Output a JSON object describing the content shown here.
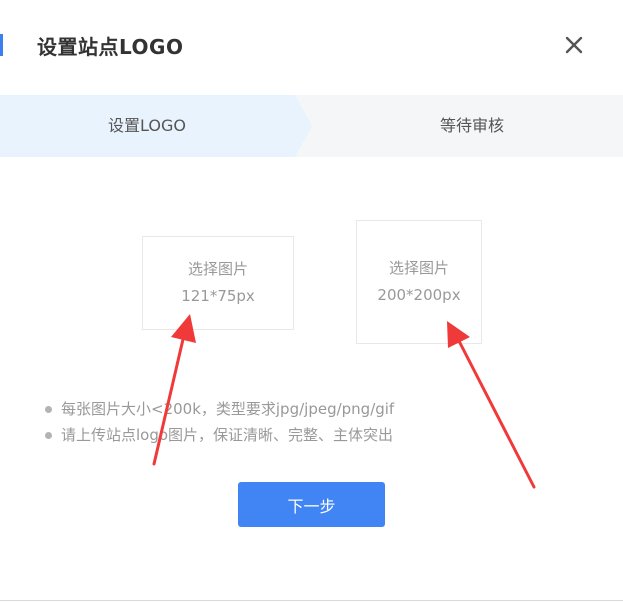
{
  "dialog": {
    "title": "设置站点LOGO",
    "close_icon": "close-icon"
  },
  "steps": [
    {
      "label": "设置LOGO",
      "active": true
    },
    {
      "label": "等待审核",
      "active": false
    }
  ],
  "uploads": [
    {
      "label": "选择图片",
      "size": "121*75px"
    },
    {
      "label": "选择图片",
      "size": "200*200px"
    }
  ],
  "notes": [
    "每张图片大小<200k，类型要求jpg/jpeg/png/gif",
    "请上传站点logo图片，保证清晰、完整、主体突出"
  ],
  "buttons": {
    "next": "下一步"
  },
  "colors": {
    "accent": "#3d7ff0",
    "primary_button": "#4184f4",
    "active_step_bg": "#e8f3fd",
    "annotation_arrow": "#f03a3a"
  }
}
